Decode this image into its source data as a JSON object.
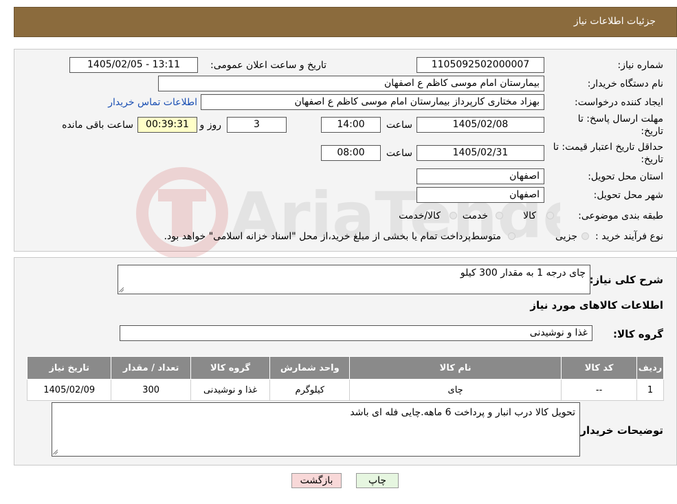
{
  "header": {
    "title": "جزئیات اطلاعات نیاز"
  },
  "form": {
    "need_number_label": "شماره نیاز:",
    "need_number": "1105092502000007",
    "announce_label": "تاریخ و ساعت اعلان عمومی:",
    "announce_value": "1405/02/05 - 13:11",
    "buyer_org_label": "نام دستگاه خریدار:",
    "buyer_org": "بیمارستان امام موسی کاظم ع  اصفهان",
    "requester_label": "ایجاد کننده درخواست:",
    "requester": "بهزاد مختاری کارپرداز بیمارستان امام موسی کاظم ع  اصفهان",
    "contact_link": "اطلاعات تماس خریدار",
    "deadline_label_1": "مهلت ارسال پاسخ: تا",
    "deadline_label_2": "تاریخ:",
    "deadline_date": "1405/02/08",
    "time_label": "ساعت",
    "deadline_time": "14:00",
    "days_value": "3",
    "days_label": "روز و",
    "remaining_time": "00:39:31",
    "remaining_label": "ساعت باقی مانده",
    "validity_label_1": "حداقل تاریخ اعتبار قیمت: تا",
    "validity_label_2": "تاریخ:",
    "validity_date": "1405/02/31",
    "validity_time": "08:00",
    "province_label": "استان محل تحویل:",
    "province": "اصفهان",
    "city_label": "شهر محل تحویل:",
    "city": "اصفهان",
    "category_label": "طبقه بندی موضوعی:",
    "category_options": [
      "کالا",
      "خدمت",
      "کالا/خدمت"
    ],
    "process_label": "نوع فرآیند خرید :",
    "process_options": [
      "جزیی",
      "متوسط"
    ],
    "process_note": "پرداخت تمام یا بخشی از مبلغ خرید،از محل \"اسناد خزانه اسلامی\" خواهد بود."
  },
  "details": {
    "summary_label": "شرح کلی نیاز:",
    "summary": "چای درجه 1 به مقدار 300 کیلو",
    "goods_info_title": "اطلاعات کالاهای مورد نیاز",
    "goods_group_label": "گروه کالا:",
    "goods_group": "غذا و نوشیدنی",
    "table": {
      "headers": [
        "ردیف",
        "کد کالا",
        "نام کالا",
        "واحد شمارش",
        "گروه کالا",
        "تعداد / مقدار",
        "تاریخ نیاز"
      ],
      "rows": [
        [
          "1",
          "--",
          "چای",
          "کیلوگرم",
          "غذا و نوشیدنی",
          "300",
          "1405/02/09"
        ]
      ]
    },
    "buyer_notes_label": "توضیحات خریدار:",
    "buyer_notes": "تحویل کالا درب انبار و پرداخت 6 ماهه.چایی فله ای باشد"
  },
  "buttons": {
    "print": "چاپ",
    "back": "بازگشت"
  },
  "colors": {
    "header_bg": "#8B6B3D",
    "table_header": "#8a8a8a",
    "timer_bg": "#FFFFC8",
    "back_btn_bg": "#F8D8D8",
    "print_btn_bg": "#E6F6E0"
  }
}
